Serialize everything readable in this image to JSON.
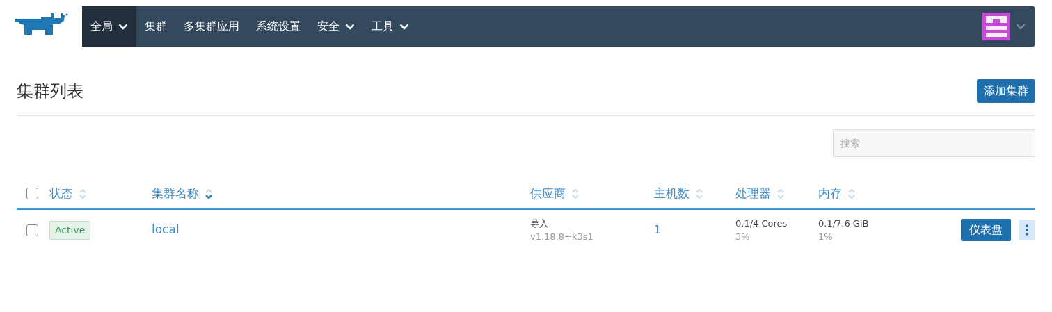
{
  "nav": {
    "items": [
      {
        "label": "全局",
        "dropdown": true,
        "selected": true
      },
      {
        "label": "集群",
        "dropdown": false,
        "selected": false
      },
      {
        "label": "多集群应用",
        "dropdown": false,
        "selected": false
      },
      {
        "label": "系统设置",
        "dropdown": false,
        "selected": false
      },
      {
        "label": "安全",
        "dropdown": true,
        "selected": false
      },
      {
        "label": "工具",
        "dropdown": true,
        "selected": false
      }
    ]
  },
  "page": {
    "title": "集群列表",
    "add_button": "添加集群"
  },
  "search": {
    "placeholder": "搜索"
  },
  "table": {
    "select_all": {
      "checked": false
    },
    "columns": [
      {
        "label": "状态",
        "sorted": false
      },
      {
        "label": "集群名称",
        "sorted": true
      },
      {
        "label": "供应商",
        "sorted": false
      },
      {
        "label": "主机数",
        "sorted": false
      },
      {
        "label": "处理器",
        "sorted": false
      },
      {
        "label": "内存",
        "sorted": false
      }
    ],
    "rows": [
      {
        "checked": false,
        "status": "Active",
        "name": "local",
        "provider": "导入",
        "version": "v1.18.8+k3s1",
        "hosts": "1",
        "cpu": "0.1/4 Cores",
        "cpu_pct": "3%",
        "memory": "0.1/7.6 GiB",
        "memory_pct": "1%",
        "action": "仪表盘"
      }
    ]
  }
}
